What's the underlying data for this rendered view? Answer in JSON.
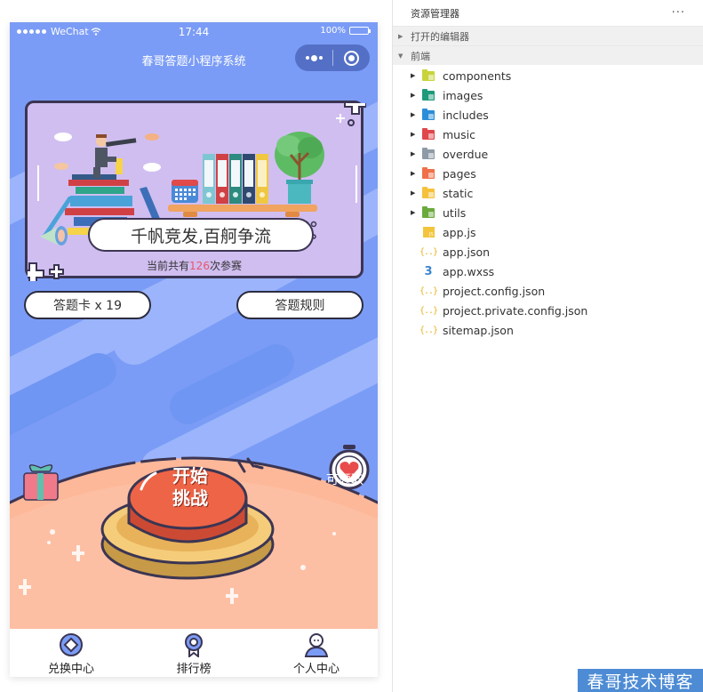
{
  "statusbar": {
    "carrier": "WeChat",
    "time": "17:44",
    "battery": "100%"
  },
  "navbar": {
    "title": "春哥答题小程序系统",
    "capsule_more": "more-icon",
    "capsule_close": "close-mini-program-icon"
  },
  "banner": {
    "slogan": "千帆竞发,百舸争流",
    "count_prefix": "当前共有",
    "count_value": "126",
    "count_suffix": "次参赛"
  },
  "buttons": {
    "answer_cards": "答题卡 x 19",
    "rules": "答题规则"
  },
  "play": {
    "start_line1": "开始",
    "start_line2": "挑战",
    "claim_label": "可领取"
  },
  "tabbar": [
    {
      "label": "兑换中心",
      "icon": "exchange-coin-icon"
    },
    {
      "label": "排行榜",
      "icon": "ranking-medal-icon"
    },
    {
      "label": "个人中心",
      "icon": "user-profile-icon"
    }
  ],
  "explorer": {
    "title": "资源管理器",
    "more": "···",
    "open_editors": "打开的编辑器",
    "project": "前端",
    "folders": [
      {
        "name": "components",
        "color": "#c8d43a"
      },
      {
        "name": "images",
        "color": "#1f9a7a"
      },
      {
        "name": "includes",
        "color": "#2b8ed8"
      },
      {
        "name": "music",
        "color": "#e0474c"
      },
      {
        "name": "overdue",
        "color": "#8e9aa6"
      },
      {
        "name": "pages",
        "color": "#f0704a"
      },
      {
        "name": "static",
        "color": "#f5c23c"
      },
      {
        "name": "utils",
        "color": "#6aaa3c"
      }
    ],
    "files": [
      {
        "name": "app.js",
        "type": "js"
      },
      {
        "name": "app.json",
        "type": "json"
      },
      {
        "name": "app.wxss",
        "type": "css"
      },
      {
        "name": "project.config.json",
        "type": "json"
      },
      {
        "name": "project.private.config.json",
        "type": "json"
      },
      {
        "name": "sitemap.json",
        "type": "json"
      }
    ]
  },
  "watermark": "春哥技术博客",
  "colors": {
    "phone_bg": "#7b9cf6",
    "banner_bg": "#d0bef0",
    "count_highlight": "#e8566c",
    "start_button": "#e9573f",
    "play_area": "#fdb899"
  }
}
